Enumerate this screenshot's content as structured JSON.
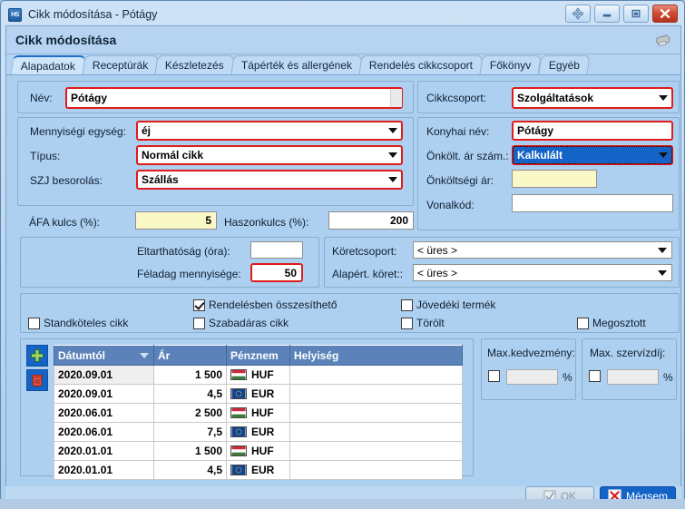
{
  "window": {
    "app_icon_label": "HS",
    "title": "Cikk módosítása - Pótágy",
    "buttons": {
      "move_label": "move",
      "minimize_label": "minimize",
      "maximize_label": "maximize",
      "close_label": "X"
    }
  },
  "form": {
    "header_title": "Cikk módosítása",
    "print_icon": "printer-icon"
  },
  "tabs": [
    {
      "label": "Alapadatok",
      "active": true
    },
    {
      "label": "Receptúrák",
      "active": false
    },
    {
      "label": "Készletezés",
      "active": false
    },
    {
      "label": "Tápérték és allergének",
      "active": false
    },
    {
      "label": "Rendelés cikkcsoport",
      "active": false
    },
    {
      "label": "Főkönyv",
      "active": false
    },
    {
      "label": "Egyéb",
      "active": false
    }
  ],
  "fields": {
    "nev": {
      "label": "Név:",
      "value": "Pótágy"
    },
    "cikkcsoport": {
      "label": "Cikkcsoport:",
      "value": "Szolgáltatások"
    },
    "mennyisegi_egyseg": {
      "label": "Mennyiségi egység:",
      "value": "éj"
    },
    "konyhai_nev": {
      "label": "Konyhai név:",
      "value": "Pótágy"
    },
    "tipus": {
      "label": "Típus:",
      "value": "Normál cikk"
    },
    "onkolt_ar_szam": {
      "label": "Önkölt. ár szám.:",
      "value": "Kalkulált"
    },
    "szj_besorolas": {
      "label": "SZJ besorolás:",
      "value": "Szállás"
    },
    "onkoltsegi_ar": {
      "label": "Önköltségi ár:",
      "value": ""
    },
    "afa_kulcs": {
      "label": "ÁFA kulcs (%):",
      "value": "5"
    },
    "haszonkulcs": {
      "label": "Haszonkulcs (%):",
      "value": "200"
    },
    "vonalkod": {
      "label": "Vonalkód:",
      "value": ""
    },
    "eltarthatosag": {
      "label": "Eltarthatóság (óra):",
      "value": ""
    },
    "feladag_mennyisege": {
      "label": "Féladag mennyisége:",
      "value": "50"
    },
    "koretcsoport": {
      "label": "Köretcsoport:",
      "value": "< üres >"
    },
    "alapert_koret": {
      "label": "Alapért. köret::",
      "value": "< üres >"
    }
  },
  "checkboxes": [
    {
      "label": "Standköteles cikk",
      "checked": false
    },
    {
      "label": "Rendelésben összesíthető",
      "checked": true
    },
    {
      "label": "Szabadáras cikk",
      "checked": false
    },
    {
      "label": "Jövedéki termék",
      "checked": false
    },
    {
      "label": "Törölt",
      "checked": false
    },
    {
      "label": "Megosztott",
      "checked": false
    }
  ],
  "grid": {
    "tools": {
      "add_label": "add-row",
      "delete_label": "delete-row"
    },
    "columns": [
      "Dátumtól",
      "Ár",
      "Pénznem",
      "Helyiség"
    ],
    "sorted_column": "Dátumtól",
    "rows": [
      {
        "datum": "2020.09.01",
        "ar": "1 500",
        "penznem": "HUF",
        "flag": "hu",
        "helyiseg": ""
      },
      {
        "datum": "2020.09.01",
        "ar": "4,5",
        "penznem": "EUR",
        "flag": "eu",
        "helyiseg": ""
      },
      {
        "datum": "2020.06.01",
        "ar": "2 500",
        "penznem": "HUF",
        "flag": "hu",
        "helyiseg": ""
      },
      {
        "datum": "2020.06.01",
        "ar": "7,5",
        "penznem": "EUR",
        "flag": "eu",
        "helyiseg": ""
      },
      {
        "datum": "2020.01.01",
        "ar": "1 500",
        "penznem": "HUF",
        "flag": "hu",
        "helyiseg": ""
      },
      {
        "datum": "2020.01.01",
        "ar": "4,5",
        "penznem": "EUR",
        "flag": "eu",
        "helyiseg": ""
      }
    ]
  },
  "max_kedvezmeny": {
    "label": "Max.kedvezmény:",
    "checked": false,
    "value": "",
    "unit": "%"
  },
  "max_szervizdij": {
    "label": "Max. szervízdíj:",
    "checked": false,
    "value": "",
    "unit": "%"
  },
  "footer": {
    "ok_label": "OK",
    "cancel_label": "Mégsem"
  },
  "colors": {
    "accent": "#1464c8",
    "required_border": "#e01b1b",
    "yellow_field": "#fbf8c8",
    "grid_header": "#5b83b9",
    "window_bg": "#aed0f0",
    "close_button": "#cf4a32"
  }
}
